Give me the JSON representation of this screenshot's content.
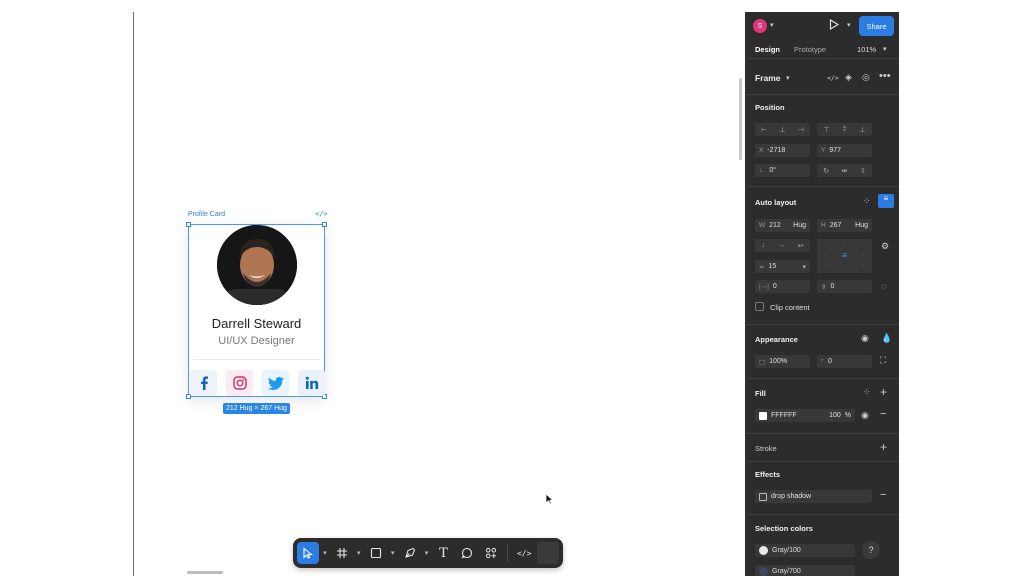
{
  "canvas": {
    "frame_label": "Profile Card",
    "code_badge": "</>",
    "card": {
      "name": "Darrell Steward",
      "role": "UI/UX Designer",
      "social": [
        "f",
        "ig",
        "tw",
        "in"
      ]
    },
    "size_tag": "212 Hug × 267 Hug"
  },
  "toolbar": {
    "tools": [
      "move-tool",
      "frame-tool",
      "shape-tool",
      "pen-tool",
      "text-tool",
      "comment-tool",
      "actions-tool",
      "dev-mode-tool"
    ],
    "text_glyph": "T",
    "code_glyph": "</>"
  },
  "panel": {
    "user_initial": "S",
    "share_label": "Share",
    "tabs": {
      "design": "Design",
      "prototype": "Prototype"
    },
    "zoom": "101%",
    "frame_title": "Frame",
    "position": {
      "title": "Position",
      "x_label": "X",
      "x_value": "-2718",
      "y_label": "Y",
      "y_value": "977",
      "rotation": "0°"
    },
    "auto_layout": {
      "title": "Auto layout",
      "w_label": "W",
      "w_value": "212",
      "w_mode": "Hug",
      "h_label": "H",
      "h_value": "267",
      "h_mode": "Hug",
      "gap": "15",
      "padding_h": "0",
      "padding_v": "0",
      "clip_content": "Clip content"
    },
    "appearance": {
      "title": "Appearance",
      "opacity": "100%",
      "radius": "0"
    },
    "fill": {
      "title": "Fill",
      "hex": "FFFFFF",
      "opacity": "100",
      "percent": "%",
      "color": "#ffffff"
    },
    "stroke": {
      "title": "Stroke"
    },
    "effects": {
      "title": "Effects",
      "effect": "drop shadow"
    },
    "selection_colors": {
      "title": "Selection colors",
      "items": [
        {
          "name": "Gray/100",
          "color": "#e8e8e8"
        },
        {
          "name": "Gray/700",
          "color": "#3b4a5e"
        }
      ]
    },
    "help": "?"
  }
}
